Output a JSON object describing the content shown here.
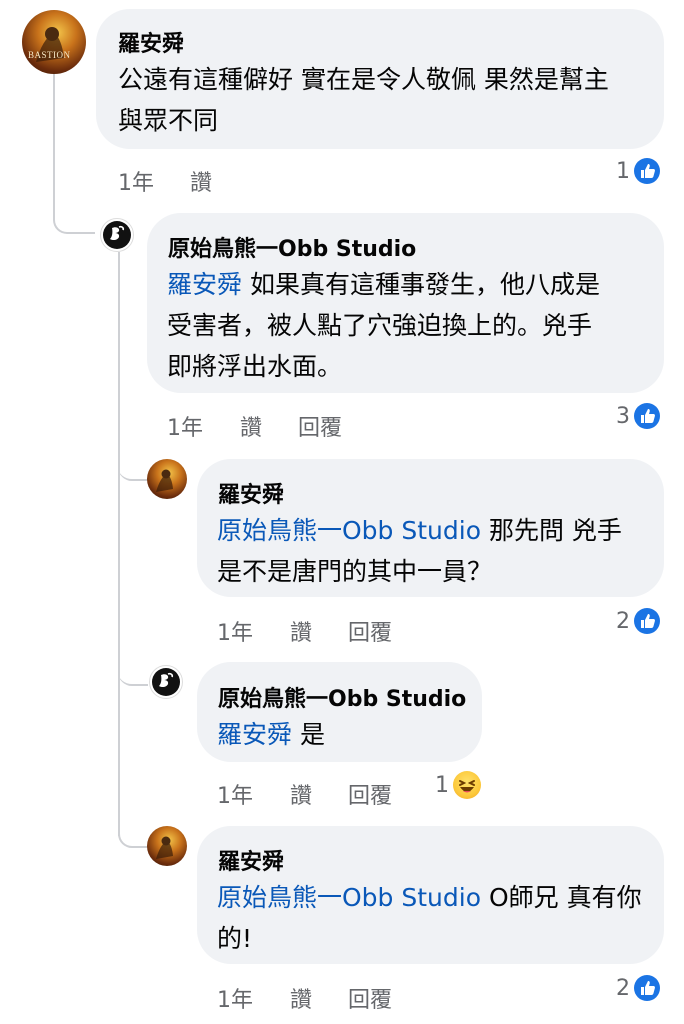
{
  "colors": {
    "mention": "#0a58b8",
    "bubble": "#f0f2f5",
    "meta": "#65676b",
    "like": "#1b74e4"
  },
  "comments": [
    {
      "author": "羅安舜",
      "text": "公遠有這種僻好 實在是令人敬佩 果然是幫主與眾不同",
      "line1": "公遠有這種僻好 實在是令人敬佩 果然是幫主",
      "line2": "與眾不同",
      "time": "1年",
      "like": "讚",
      "reaction_count": "1",
      "avatar_text": "BASTION"
    },
    {
      "author": "原始鳥熊一Obb Studio",
      "mention": "羅安舜",
      "line1": "如果真有這種事發生，他八成是",
      "line2": "受害者，被人點了穴強迫換上的。兇手",
      "line3": "即將浮出水面。",
      "time": "1年",
      "like": "讚",
      "reply": "回覆",
      "reaction_count": "3"
    },
    {
      "author": "羅安舜",
      "mention": "原始鳥熊一Obb Studio",
      "line1": "那先問 兇手",
      "line2": "是不是唐門的其中一員？",
      "time": "1年",
      "like": "讚",
      "reply": "回覆",
      "reaction_count": "2"
    },
    {
      "author": "原始鳥熊一Obb Studio",
      "mention": "羅安舜",
      "line1": "是",
      "time": "1年",
      "like": "讚",
      "reply": "回覆",
      "reaction_count": "1"
    },
    {
      "author": "羅安舜",
      "mention": "原始鳥熊一Obb Studio",
      "line1": "O師兄 真有你",
      "line2": "的!",
      "time": "1年",
      "like": "讚",
      "reply": "回覆",
      "reaction_count": "2"
    }
  ]
}
